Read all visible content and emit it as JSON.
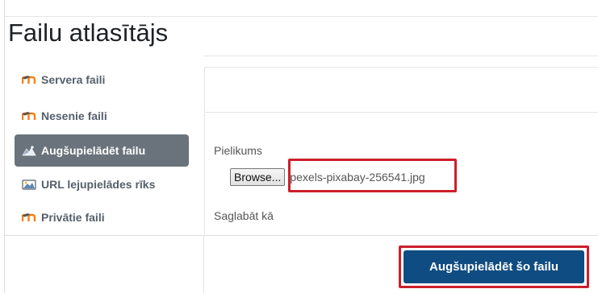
{
  "dialog": {
    "title": "Failu atlasītājs"
  },
  "sidebar": {
    "items": [
      {
        "label": "Servera faili",
        "icon": "moodle-icon",
        "active": false
      },
      {
        "label": "Nesenie faili",
        "icon": "moodle-icon",
        "active": false
      },
      {
        "label": "Augšupielādēt failu",
        "icon": "upload-repository-icon",
        "active": true
      },
      {
        "label": "URL lejupielādes rīks",
        "icon": "url-downloader-icon",
        "active": false
      },
      {
        "label": "Privātie faili",
        "icon": "moodle-icon",
        "active": false
      }
    ]
  },
  "upload_form": {
    "attachment_label": "Pielikums",
    "browse_label": "Browse...",
    "selected_file": "pexels-pixabay-256541.jpg",
    "save_as_label": "Saglabāt kā"
  },
  "footer": {
    "upload_button_label": "Augšupielādēt šo failu"
  },
  "colors": {
    "active_item_bg": "#6a737b",
    "primary_button": "#0f4c81",
    "highlight_outline": "#cc1f2b",
    "moodle_orange": "#f98012"
  }
}
